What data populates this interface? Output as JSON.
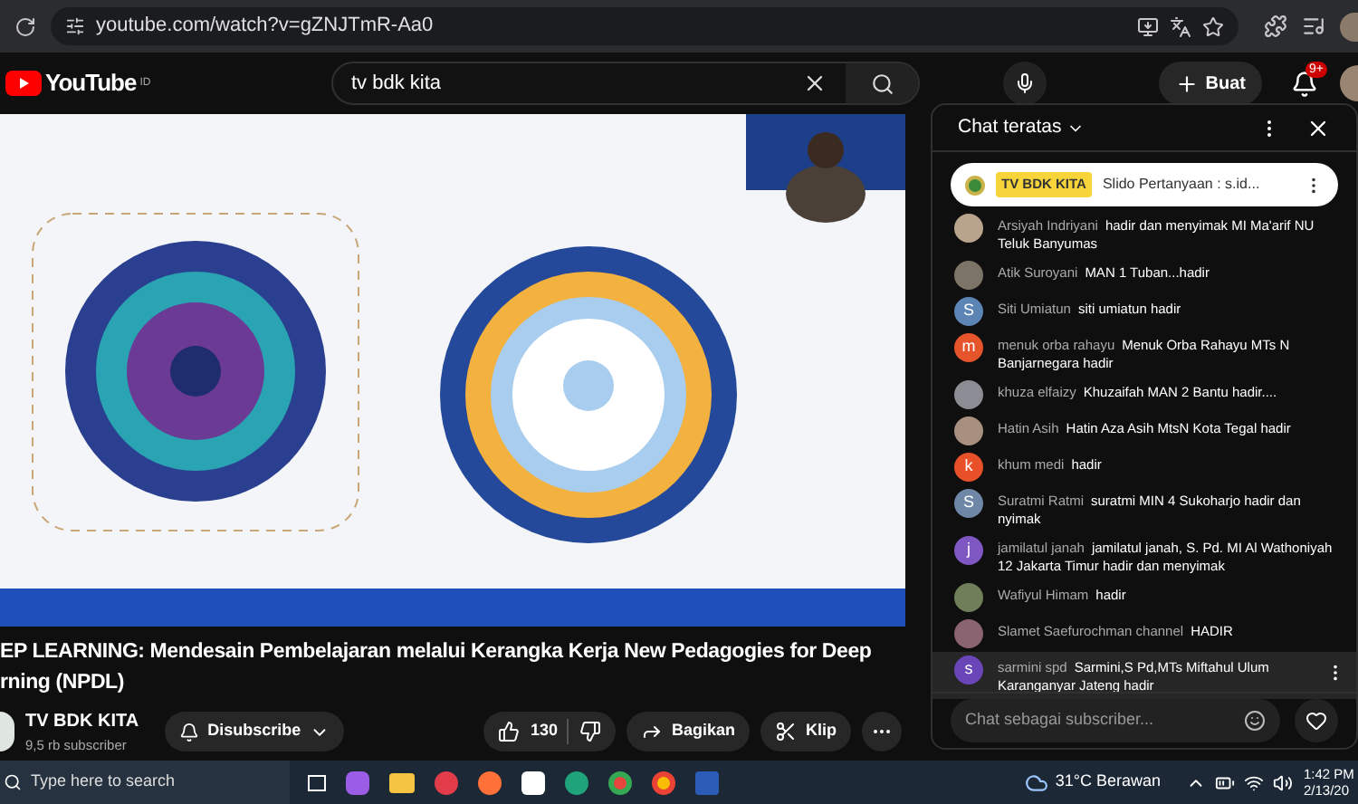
{
  "browser": {
    "url": "youtube.com/watch?v=gZNJTmR-Aa0"
  },
  "header": {
    "logo": "YouTube",
    "country": "ID",
    "search": {
      "value": "tv bdk kita"
    },
    "create_label": "Buat",
    "notifications": "9+"
  },
  "title_lines": [
    "EP LEARNING: Mendesain Pembelajaran melalui Kerangka Kerja New Pedagogies for Deep",
    "rning (NPDL)"
  ],
  "channel": {
    "name": "TV BDK KITA",
    "subscribers": "9,5 rb subscriber",
    "subscribe_label": "Disubscribe"
  },
  "actions": {
    "likes": "130",
    "share": "Bagikan",
    "clip": "Klip"
  },
  "chat": {
    "header": "Chat teratas",
    "pinned": {
      "author": "TV BDK KITA",
      "text": "Slido Pertanyaan : s.id..."
    },
    "messages": [
      {
        "author": "Arsiyah Indriyani",
        "text": "hadir dan menyimak MI Ma'arif NU Teluk Banyumas",
        "selected": false
      },
      {
        "author": "Atik Suroyani",
        "text": "MAN 1 Tuban...hadir",
        "selected": false
      },
      {
        "author": "Siti Umiatun",
        "text": "siti umiatun hadir",
        "avatar": {
          "kind": "letter",
          "letter": "S",
          "color": "#5c85b5"
        },
        "selected": false
      },
      {
        "author": "menuk orba rahayu",
        "text": "Menuk Orba Rahayu MTs N Banjarnegara hadir",
        "avatar": {
          "kind": "letter",
          "letter": "m",
          "color": "#e6542c"
        },
        "selected": false
      },
      {
        "author": "khuza elfaizy",
        "text": "Khuzaifah MAN 2 Bantu hadir....",
        "selected": false
      },
      {
        "author": "Hatin Asih",
        "text": "Hatin Aza Asih MtsN Kota Tegal hadir",
        "selected": false
      },
      {
        "author": "khum medi",
        "text": "hadir",
        "avatar": {
          "kind": "letter",
          "letter": "k",
          "color": "#e8502a"
        },
        "selected": false
      },
      {
        "author": "Suratmi Ratmi",
        "text": "suratmi MIN 4 Sukoharjo hadir dan nyimak",
        "avatar": {
          "kind": "letter",
          "letter": "S",
          "color": "#6f87a6"
        },
        "selected": false
      },
      {
        "author": "jamilatul janah",
        "text": "jamilatul janah, S. Pd. MI Al Wathoniyah 12 Jakarta Timur hadir dan menyimak",
        "avatar": {
          "kind": "letter",
          "letter": "j",
          "color": "#7e57c2"
        },
        "selected": false
      },
      {
        "author": "Wafiyul Himam",
        "text": "hadir",
        "selected": false
      },
      {
        "author": "Slamet Saefurochman channel",
        "text": "HADIR",
        "selected": false
      },
      {
        "author": "sarmini spd",
        "text": "Sarmini,S Pd,MTs Miftahul Ulum Karanganyar Jateng hadir",
        "avatar": {
          "kind": "letter",
          "letter": "s",
          "color": "#6a45b8"
        },
        "selected": true
      }
    ],
    "input": {
      "placeholder": "Chat sebagai subscriber..."
    }
  },
  "taskbar": {
    "search_placeholder": "Type here to search",
    "weather": {
      "temp": "31°C",
      "condition": "Berawan"
    },
    "time": "1:42 PM",
    "date": "2/13/20"
  }
}
